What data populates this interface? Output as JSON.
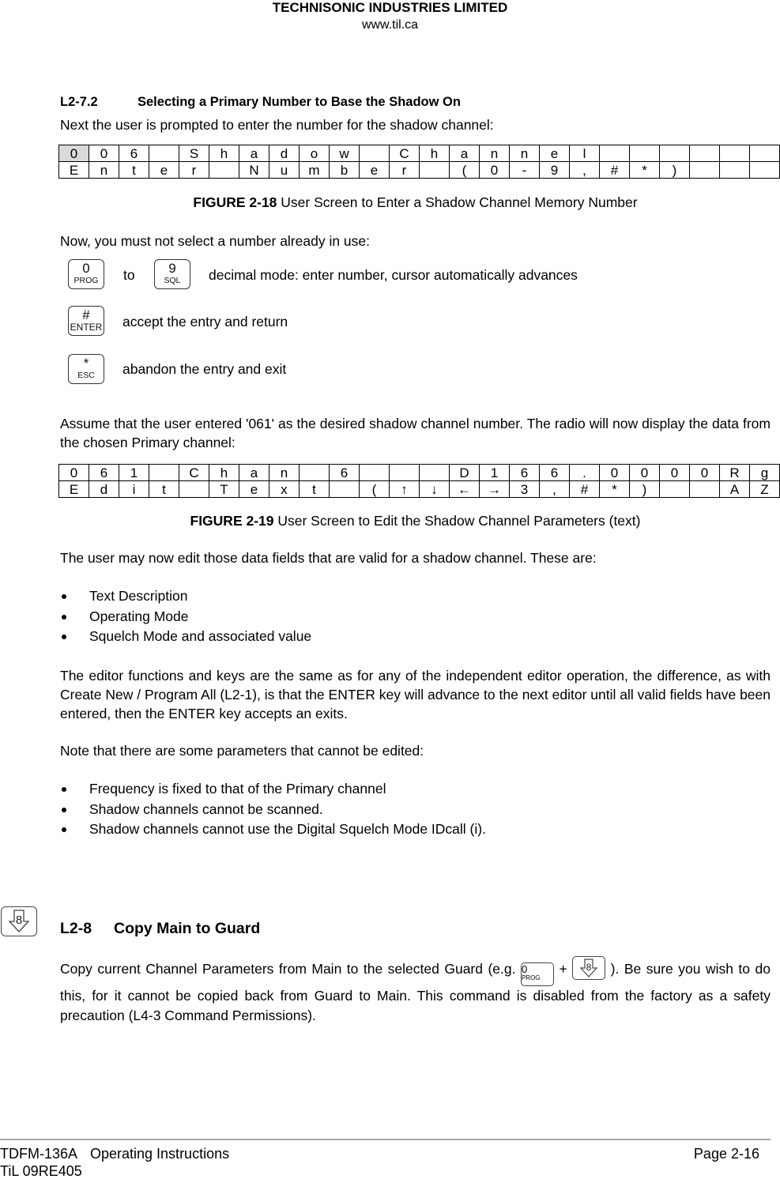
{
  "header": {
    "company": "TECHNISONIC INDUSTRIES LIMITED",
    "url": "www.til.ca"
  },
  "section_l2_7_2": {
    "number": "L2-7.2",
    "title": "Selecting a Primary Number to Base the Shadow On",
    "intro": "Next the user is prompted to enter the number for the shadow channel:"
  },
  "figure_2_18": {
    "rows": [
      [
        "0",
        "0",
        "6",
        "",
        "S",
        "h",
        "a",
        "d",
        "o",
        "w",
        "",
        "C",
        "h",
        "a",
        "n",
        "n",
        "e",
        "l",
        "",
        "",
        "",
        "",
        "",
        ""
      ],
      [
        "E",
        "n",
        "t",
        "e",
        "r",
        "",
        "N",
        "u",
        "m",
        "b",
        "e",
        "r",
        "",
        "(",
        "0",
        "-",
        "9",
        ",",
        "#",
        "*",
        ")",
        "",
        "",
        ""
      ]
    ],
    "cursor_cell": 0,
    "caption_label": "FIGURE 2-18",
    "caption_text": " User Screen to Enter a Shadow Channel Memory Number"
  },
  "key_instructions": {
    "intro": "Now, you must not select a number already in use:",
    "keys": [
      {
        "top": "0",
        "bottom": "PROG"
      },
      {
        "top": "9",
        "bottom": "SQL"
      },
      {
        "top": "#",
        "bottom": "ENTER"
      },
      {
        "top": "*",
        "bottom": "ESC"
      }
    ],
    "to_label": "to",
    "digit_desc": "decimal mode: enter number, cursor automatically advances",
    "enter_desc": "accept the entry and return",
    "esc_desc": "abandon the entry and exit"
  },
  "assume_paragraph": "Assume that the user entered '061' as the desired shadow channel number. The radio will now display the data from the chosen Primary channel:",
  "figure_2_19": {
    "rows": [
      [
        "0",
        "6",
        "1",
        "",
        "C",
        "h",
        "a",
        "n",
        "",
        "6",
        "",
        "",
        "",
        "D",
        "1",
        "6",
        "6",
        ".",
        "0",
        "0",
        "0",
        "0",
        "R",
        "g"
      ],
      [
        "E",
        "d",
        "i",
        "t",
        "",
        "T",
        "e",
        "x",
        "t",
        "",
        "(",
        "↑",
        "↓",
        "←",
        "→",
        "3",
        ",",
        "#",
        "*",
        ")",
        "",
        "",
        "A",
        "Z"
      ]
    ],
    "caption_label": "FIGURE 2-19",
    "caption_text": " User Screen to Edit the Shadow Channel Parameters (text)"
  },
  "editable_fields": {
    "intro": "The user may now edit those data fields that are valid for a shadow channel. These are:",
    "items": [
      "Text Description",
      "Operating Mode",
      "Squelch Mode and associated value"
    ]
  },
  "editor_paragraph": "The editor functions and keys are the same as for any of the independent editor operation, the difference, as with Create New  / Program All (L2-1), is that the ENTER key will advance to the next editor until all valid fields have been entered, then the ENTER key accepts an exits.",
  "non_editable": {
    "intro": "Note that there are some parameters that cannot be edited:",
    "items": [
      "Frequency is fixed to that of the Primary channel",
      "Shadow channels cannot be scanned.",
      "Shadow channels cannot use the Digital Squelch Mode IDcall (i)."
    ]
  },
  "section_l2_8": {
    "number": "L2-8",
    "title": "Copy Main to Guard",
    "icon_key_label": "8",
    "para_part1": "Copy current Channel Parameters from Main to the selected Guard (e.g. ",
    "inline_key_top": "0",
    "inline_key_bottom": "PROG",
    "plus": " + ",
    "inline_arrow_key_label": "8",
    "para_part2": " ). Be sure you wish to do this, for it cannot be copied back from Guard to Main. This command is disabled from the factory as a safety precaution (L4-3 Command Permissions)."
  },
  "footer": {
    "model": "TDFM-136A",
    "doc_title": "Operating Instructions",
    "doc_code": "TiL 09RE405",
    "page": "Page 2-16"
  }
}
